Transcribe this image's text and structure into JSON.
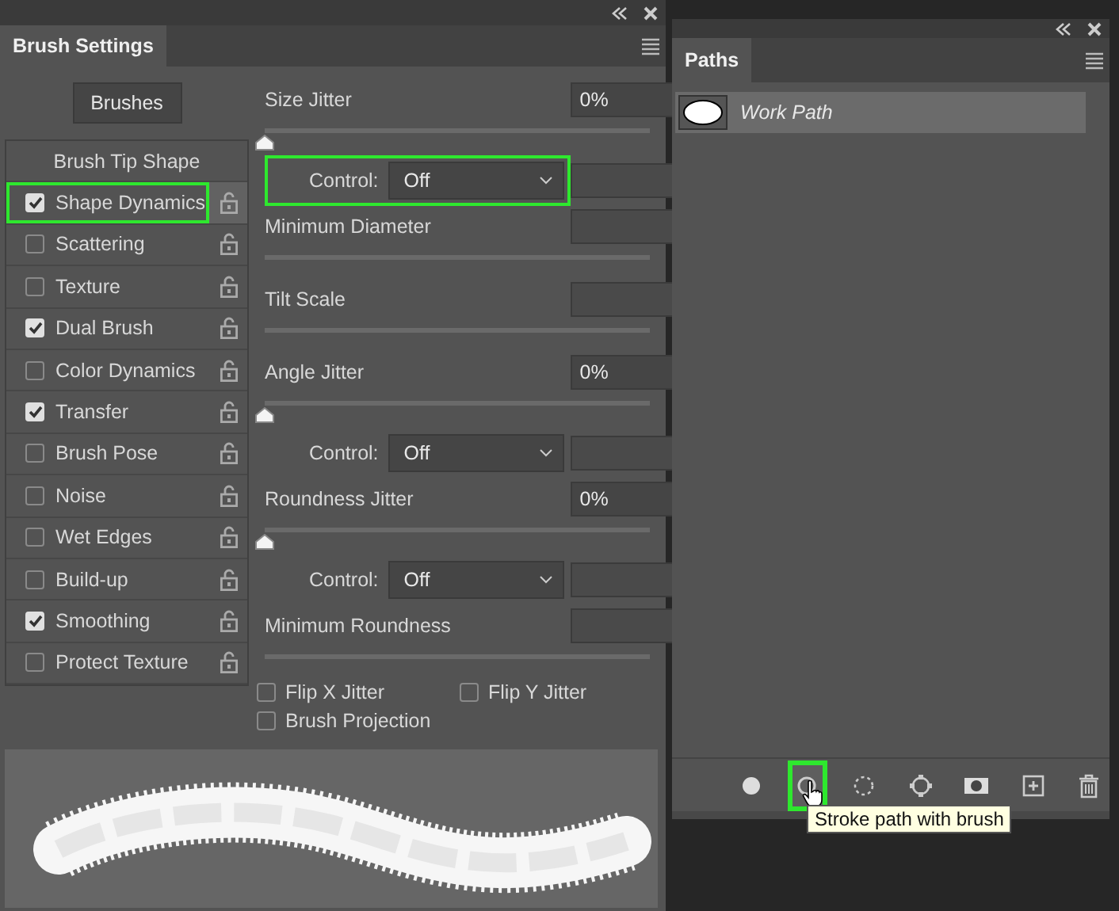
{
  "brush_settings": {
    "title": "Brush Settings",
    "brushes_button": "Brushes",
    "options": [
      {
        "kind": "header",
        "label": "Brush Tip Shape"
      },
      {
        "kind": "checkbox",
        "label": "Shape Dynamics",
        "checked": true,
        "selected": true,
        "highlighted": true
      },
      {
        "kind": "checkbox",
        "label": "Scattering",
        "checked": false,
        "selected": false,
        "highlighted": false
      },
      {
        "kind": "checkbox",
        "label": "Texture",
        "checked": false,
        "selected": false,
        "highlighted": false
      },
      {
        "kind": "checkbox",
        "label": "Dual Brush",
        "checked": true,
        "selected": false,
        "highlighted": false
      },
      {
        "kind": "checkbox",
        "label": "Color Dynamics",
        "checked": false,
        "selected": false,
        "highlighted": false
      },
      {
        "kind": "checkbox",
        "label": "Transfer",
        "checked": true,
        "selected": false,
        "highlighted": false
      },
      {
        "kind": "checkbox",
        "label": "Brush Pose",
        "checked": false,
        "selected": false,
        "highlighted": false
      },
      {
        "kind": "checkbox",
        "label": "Noise",
        "checked": false,
        "selected": false,
        "highlighted": false
      },
      {
        "kind": "checkbox",
        "label": "Wet Edges",
        "checked": false,
        "selected": false,
        "highlighted": false
      },
      {
        "kind": "checkbox",
        "label": "Build-up",
        "checked": false,
        "selected": false,
        "highlighted": false
      },
      {
        "kind": "checkbox",
        "label": "Smoothing",
        "checked": true,
        "selected": false,
        "highlighted": false
      },
      {
        "kind": "checkbox",
        "label": "Protect Texture",
        "checked": false,
        "selected": false,
        "highlighted": false
      }
    ],
    "settings": [
      {
        "kind": "slider",
        "label": "Size Jitter",
        "value": "0%",
        "level": 0
      },
      {
        "kind": "control",
        "label": "Control:",
        "value": "Off",
        "highlighted": true
      },
      {
        "kind": "slider",
        "label": "Minimum Diameter"
      },
      {
        "kind": "slider",
        "label": "Tilt Scale"
      },
      {
        "kind": "slider",
        "label": "Angle Jitter",
        "value": "0%",
        "level": 0
      },
      {
        "kind": "control",
        "label": "Control:",
        "value": "Off",
        "highlighted": false
      },
      {
        "kind": "slider",
        "label": "Roundness Jitter",
        "value": "0%",
        "level": 0
      },
      {
        "kind": "control",
        "label": "Control:",
        "value": "Off",
        "highlighted": false
      },
      {
        "kind": "slider",
        "label": "Minimum Roundness"
      }
    ],
    "flips": [
      {
        "label": "Flip X Jitter",
        "checked": false
      },
      {
        "label": "Flip Y Jitter",
        "checked": false
      },
      {
        "label": "Brush Projection",
        "checked": false
      }
    ]
  },
  "paths": {
    "title": "Paths",
    "items": [
      {
        "name": "Work Path",
        "selected": true
      }
    ],
    "footer": [
      {
        "kind": "fill",
        "highlighted": false
      },
      {
        "kind": "stroke",
        "highlighted": true
      },
      {
        "kind": "selection",
        "highlighted": false
      },
      {
        "kind": "workpath",
        "highlighted": false
      },
      {
        "kind": "mask",
        "highlighted": false
      },
      {
        "kind": "new",
        "highlighted": false
      },
      {
        "kind": "trash",
        "highlighted": false
      }
    ],
    "tooltip": "Stroke path with brush"
  }
}
